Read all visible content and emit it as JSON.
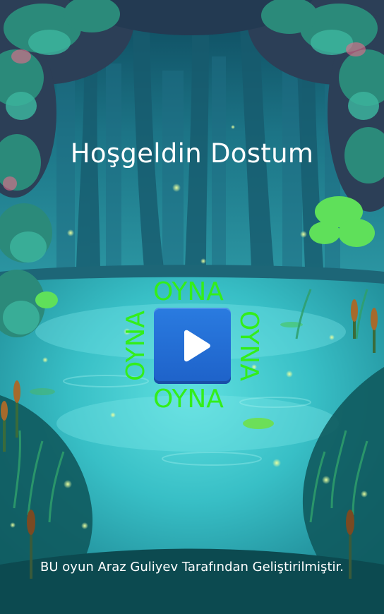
{
  "screen": {
    "welcome_title": "Hoşgeldin Dostum",
    "play": {
      "labels": {
        "top": "OYNA",
        "left": "OYNA",
        "right": "OYNA",
        "bottom": "OYNA"
      },
      "button_icon": "play-icon",
      "label_color": "#33ee1a",
      "button_color": "#1e62c9"
    },
    "credit": "BU oyun Araz Guliyev Tarafından Geliştirilmiştir."
  }
}
